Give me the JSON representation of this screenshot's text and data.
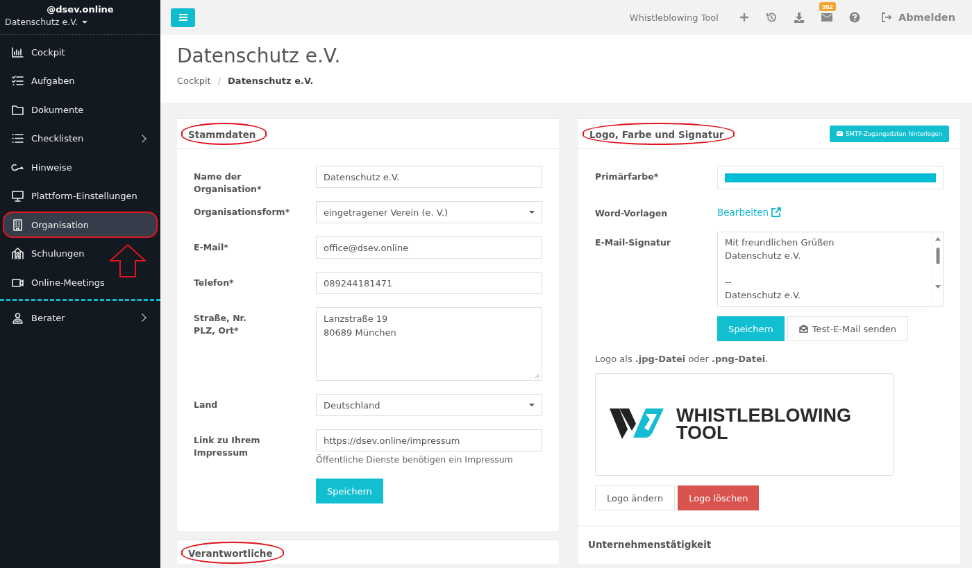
{
  "sidebar": {
    "user": "@dsev.online",
    "org": "Datenschutz e.V.",
    "items": [
      {
        "label": "Cockpit",
        "selected": false,
        "has_submenu": false
      },
      {
        "label": "Aufgaben",
        "selected": false,
        "has_submenu": false
      },
      {
        "label": "Dokumente",
        "selected": false,
        "has_submenu": false
      },
      {
        "label": "Checklisten",
        "selected": false,
        "has_submenu": true
      },
      {
        "label": "Hinweise",
        "selected": false,
        "has_submenu": false
      },
      {
        "label": "Plattform-Einstellungen",
        "selected": false,
        "has_submenu": false
      },
      {
        "label": "Organisation",
        "selected": true,
        "has_submenu": false,
        "highlighted": true
      },
      {
        "label": "Schulungen",
        "selected": false,
        "has_submenu": false
      },
      {
        "label": "Online-Meetings",
        "selected": false,
        "has_submenu": false
      }
    ],
    "footer_items": [
      {
        "label": "Berater",
        "selected": false,
        "has_submenu": true
      }
    ]
  },
  "annotation_arrow": true,
  "topbar": {
    "app_name": "Whistleblowing Tool",
    "badge": "352",
    "logout": "Abmelden"
  },
  "page": {
    "title": "Datenschutz e.V.",
    "breadcrumb_separator": "/",
    "breadcrumb": [
      {
        "label": "Cockpit",
        "current": false
      },
      {
        "label": "Datenschutz e.V.",
        "current": true
      }
    ]
  },
  "stammdaten": {
    "title": "Stammdaten",
    "highlighted": true,
    "fields": [
      {
        "kind": "input",
        "label": "Name der Organisation*",
        "value": "Datenschutz e.V."
      },
      {
        "kind": "select",
        "label": "Organisationsform*",
        "value": "eingetragener Verein (e. V.)"
      },
      {
        "kind": "input",
        "label": "E-Mail*",
        "value": "office@dsev.online"
      },
      {
        "kind": "input",
        "label": "Telefon*",
        "value": "089244181471"
      },
      {
        "kind": "textarea",
        "label": "Straße, Nr.\nPLZ, Ort*",
        "value": "Lanzstraße 19\n80689 München"
      },
      {
        "kind": "select",
        "label": "Land",
        "value": "Deutschland"
      },
      {
        "kind": "input",
        "label": "Link zu Ihrem Impressum",
        "value": "https://dsev.online/impressum",
        "help": "Öffentliche Dienste benötigen ein Impressum"
      }
    ],
    "save": "Speichern"
  },
  "branding": {
    "title": "Logo, Farbe und Signatur",
    "highlighted": true,
    "smtp_button": "SMTP-Zugangsdaten hinterlegen",
    "primary_label": "Primärfarbe*",
    "templates_label": "Word-Vorlagen",
    "templates_link": "Bearbeiten",
    "signature_label": "E-Mail-Signatur",
    "signature": "Mit freundlichen Grüßen\nDatenschutz e.V.\n\n--\nDatenschutz e.V.",
    "save": "Speichern",
    "test_mail": "Test-E-Mail senden",
    "logo_hint": "Logo als **.jpg-Datei** oder **.png-Datei**.",
    "logo_text": [
      "WHISTLEBLOWING",
      "TOOL"
    ],
    "change_logo": "Logo ändern",
    "delete_logo": "Logo löschen"
  },
  "lower_cards": [
    {
      "title": "Verantwortliche",
      "highlighted": true
    },
    {
      "title": "Unternehmenstätigkeit",
      "highlighted": false
    }
  ]
}
